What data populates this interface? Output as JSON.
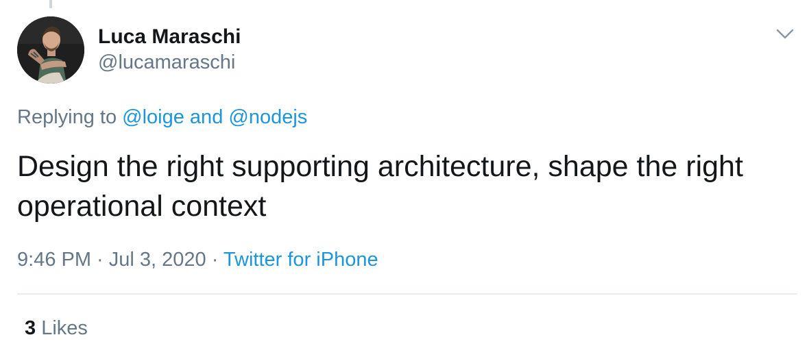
{
  "author": {
    "name": "Luca Maraschi",
    "handle": "@lucamaraschi"
  },
  "reply": {
    "prefix": "Replying to ",
    "mention1": "@loige",
    "connector": " and ",
    "mention2": "@nodejs"
  },
  "tweet": {
    "text": "Design the right supporting architecture, shape the right operational context"
  },
  "meta": {
    "time": "9:46 PM",
    "separator1": " · ",
    "date": "Jul 3, 2020",
    "separator2": " · ",
    "source": "Twitter for iPhone"
  },
  "stats": {
    "likes_count": "3",
    "likes_label": "Likes"
  },
  "icons": {
    "menu": "chevron-down-icon"
  },
  "colors": {
    "link": "#1b95e0",
    "secondary_text": "#657786",
    "primary_text": "#14171a",
    "divider": "#e6ecf0"
  }
}
